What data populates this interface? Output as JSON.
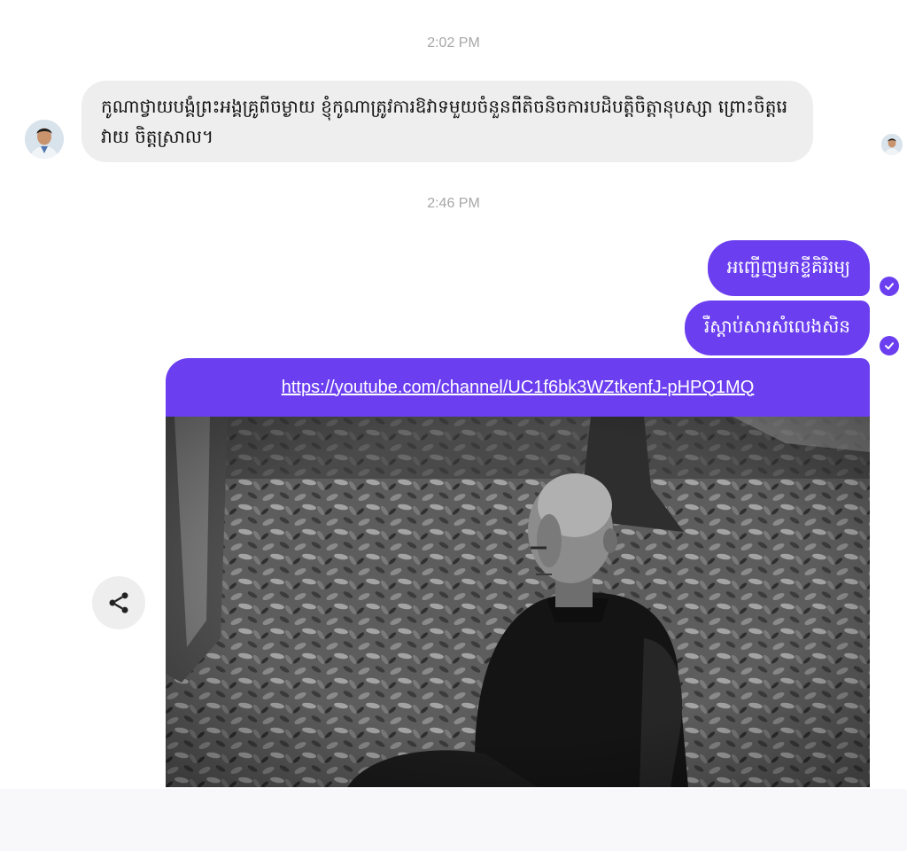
{
  "conversation": {
    "timestamps": [
      "2:02 PM",
      "2:46 PM"
    ],
    "incoming": {
      "text": "កូណាថ្វាយបង្គំព្រះអង្គគ្រូពីចម្ងាយ ខ្ញុំកូណាត្រូវការឱវាទមួយចំនួនពីតិចនិចការបដិបត្តិចិត្តានុបស្សា ព្រោះចិត្តរេវាយ ចិត្តស្រាល។"
    },
    "outgoing": [
      {
        "text": "អញ្ជើញមកខ្ទីគិរិរម្យ"
      },
      {
        "text": "រឺស្ដាប់សារសំលេងសិន"
      }
    ],
    "link_preview": {
      "url": "https://youtube.com/channel/UC1f6bk3WZtkenfJ-pHPQ1MQ",
      "thumbnail": "monk-meditating-forest-photo"
    }
  },
  "icons": {
    "read_receipt": "check-circle-icon",
    "share": "share-icon"
  },
  "colors": {
    "accent": "#6b3ff0",
    "incoming_bubble": "#eeeeee",
    "timestamp": "#a7a7a7"
  }
}
